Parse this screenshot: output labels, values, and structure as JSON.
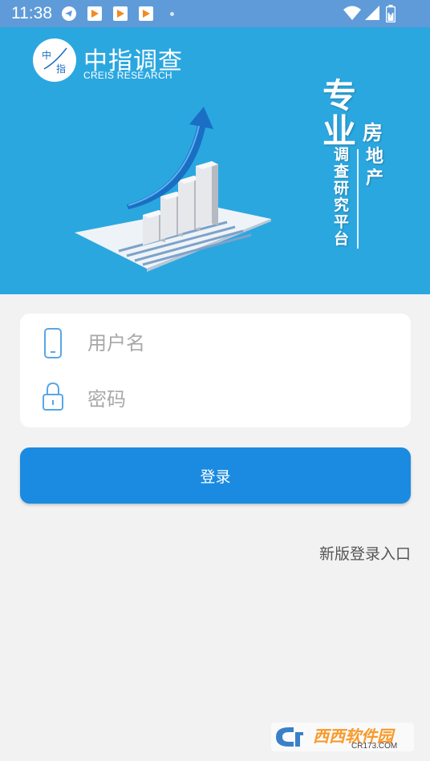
{
  "status_bar": {
    "time": "11:38",
    "icons": [
      "telegram-icon",
      "play-app-icon",
      "play-app-icon",
      "play-app-icon",
      "dot-icon",
      "wifi-icon",
      "signal-icon",
      "battery-icon"
    ]
  },
  "banner": {
    "logo_chars": [
      "中",
      "指"
    ],
    "brand_title": "中指调查",
    "brand_subtitle": "CREIS RESEARCH",
    "slogan_main": "专业",
    "slogan_fang": "房",
    "slogan_vertical_1": "地产",
    "slogan_vertical_2": "调查研究平台"
  },
  "form": {
    "username_placeholder": "用户名",
    "password_placeholder": "密码"
  },
  "login_button_label": "登录",
  "new_login_entry": "新版登录入口",
  "watermark": {
    "text": "西西软件园",
    "url": "CR173.COM"
  },
  "colors": {
    "banner": "#2ba7e0",
    "button": "#1a8be0",
    "status_bar": "#5f9bd8",
    "background": "#f2f2f3"
  }
}
